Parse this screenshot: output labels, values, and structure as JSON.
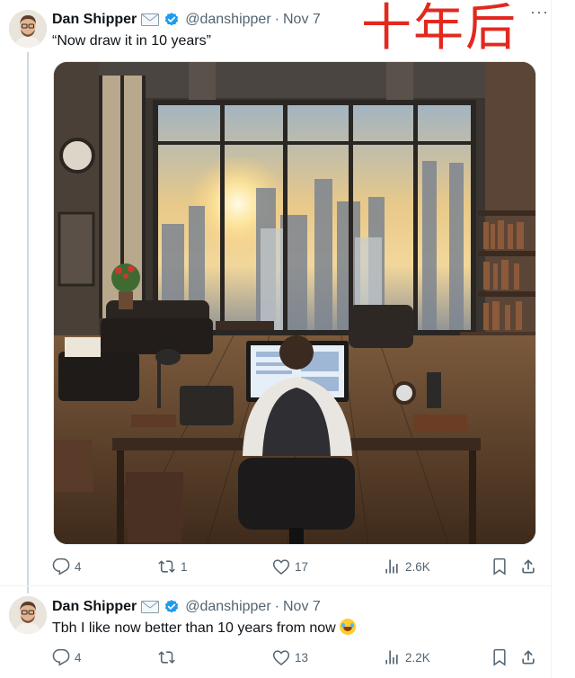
{
  "overlay_caption": "十年后",
  "tweets": [
    {
      "author_name": "Dan Shipper",
      "handle": "@danshipper",
      "separator": "·",
      "date": "Nov 7",
      "text": "“Now draw it in 10 years”",
      "media_alt_icon": "generated-office-image",
      "metrics": {
        "replies": "4",
        "reposts": "1",
        "likes": "17",
        "views": "2.6K"
      }
    },
    {
      "author_name": "Dan Shipper",
      "handle": "@danshipper",
      "separator": "·",
      "date": "Nov 7",
      "text": "Tbh I like now better than 10 years from now",
      "emoji": "face-with-tears-of-joy",
      "metrics": {
        "replies": "4",
        "reposts": "",
        "likes": "13",
        "views": "2.2K"
      }
    }
  ],
  "colors": {
    "text_primary": "#0f1419",
    "text_secondary": "#536471",
    "verified_blue": "#1d9bf0",
    "overlay_red": "#e2291f",
    "divider": "#eff3f4"
  }
}
